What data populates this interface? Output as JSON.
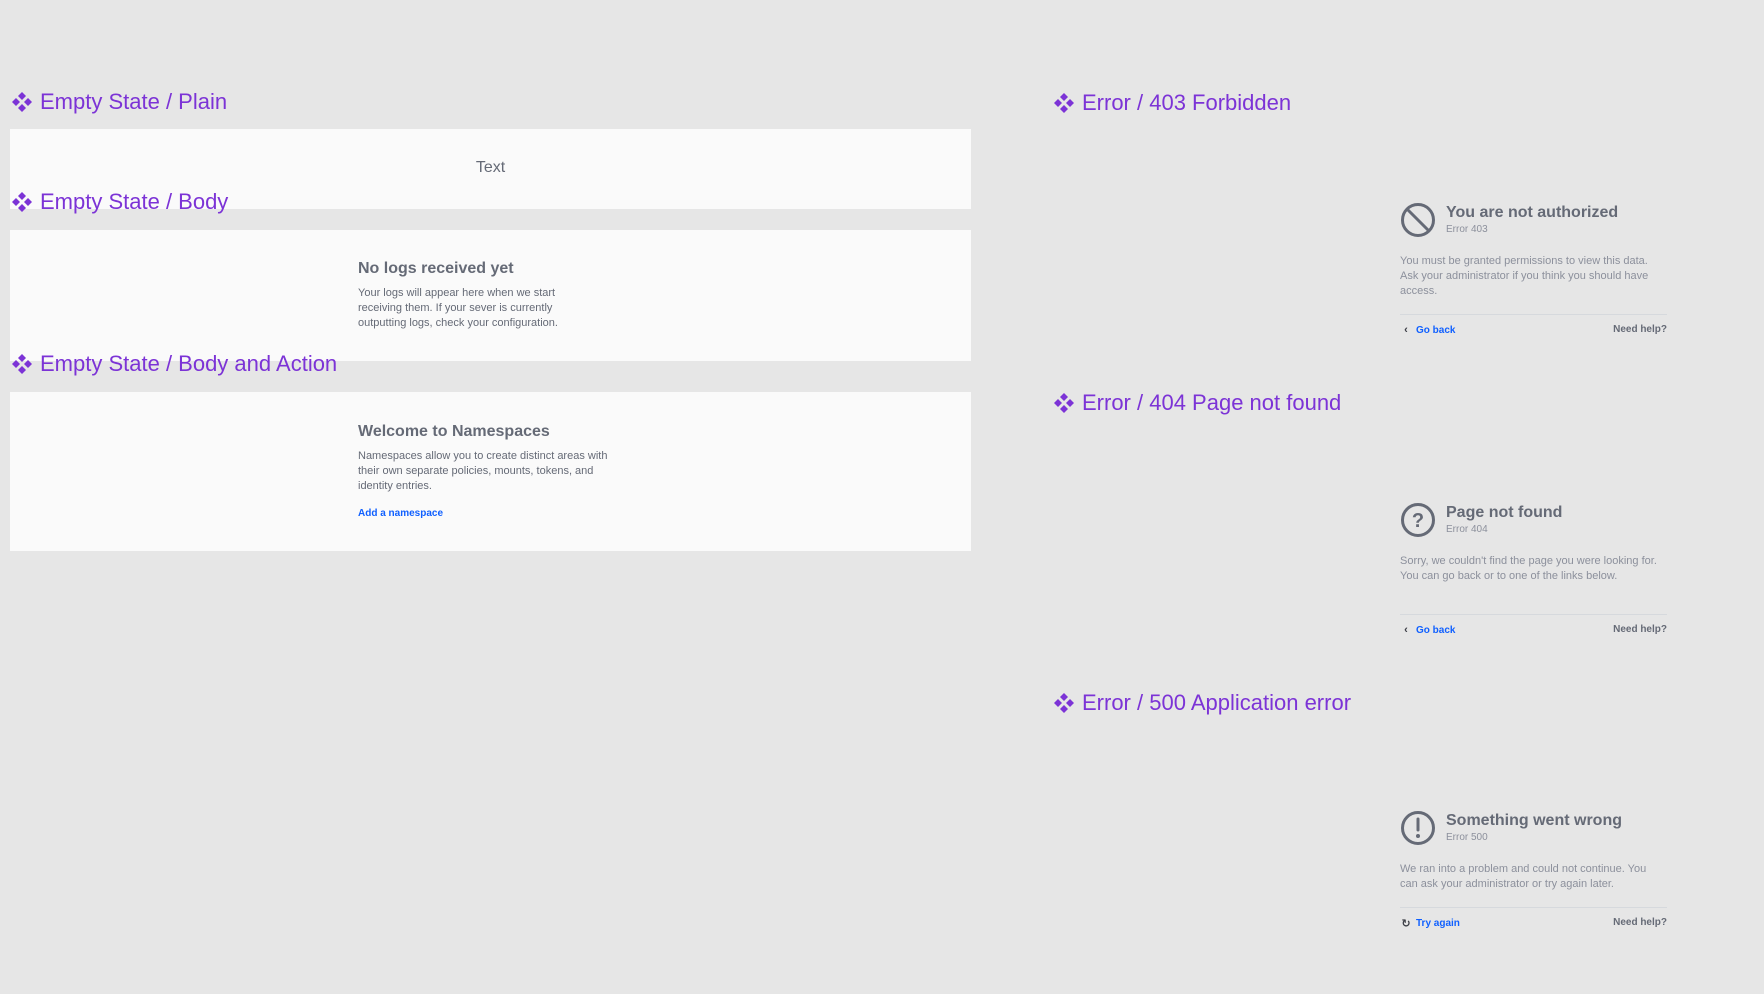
{
  "colors": {
    "canvas": "#e6e6e6",
    "frame": "#fafafa",
    "component_title": "#7c33d6",
    "heading_text": "#656a76",
    "muted_text": "#8c909c",
    "link": "#1060ff",
    "separator": "#d6d9dd"
  },
  "empty_plain": {
    "title": "Empty State / Plain",
    "text": "Text"
  },
  "empty_body": {
    "title": "Empty State / Body",
    "heading": "No logs received yet",
    "body": "Your logs will appear here when we start receiving them. If your sever is currently outputting logs, check your configuration."
  },
  "empty_body_action": {
    "title": "Empty State / Body and Action",
    "heading": "Welcome to Namespaces",
    "body": "Namespaces allow you to create distinct areas with their own separate policies, mounts, tokens, and identity entries.",
    "action": "Add a namespace"
  },
  "error_403": {
    "title": "Error / 403 Forbidden",
    "icon": "forbidden-icon",
    "heading": "You are not authorized",
    "code": "Error 403",
    "body": "You must be granted permissions to view this data. Ask your administrator if you think you should have access.",
    "action_icon": "chevron-left-icon",
    "action": "Go back",
    "help": "Need help?"
  },
  "error_404": {
    "title": "Error / 404 Page not found",
    "icon": "help-circle-icon",
    "heading": "Page not found",
    "code": "Error 404",
    "body": "Sorry, we couldn't find the page you were looking for. You can go back or to one of the links below.",
    "action_icon": "chevron-left-icon",
    "action": "Go back",
    "help": "Need help?"
  },
  "error_500": {
    "title": "Error / 500 Application error",
    "icon": "alert-circle-icon",
    "heading": "Something went wrong",
    "code": "Error 500",
    "body": "We ran into a problem and could not continue. You can ask your administrator or try again later.",
    "action_icon": "reload-icon",
    "action": "Try again",
    "help": "Need help?"
  }
}
